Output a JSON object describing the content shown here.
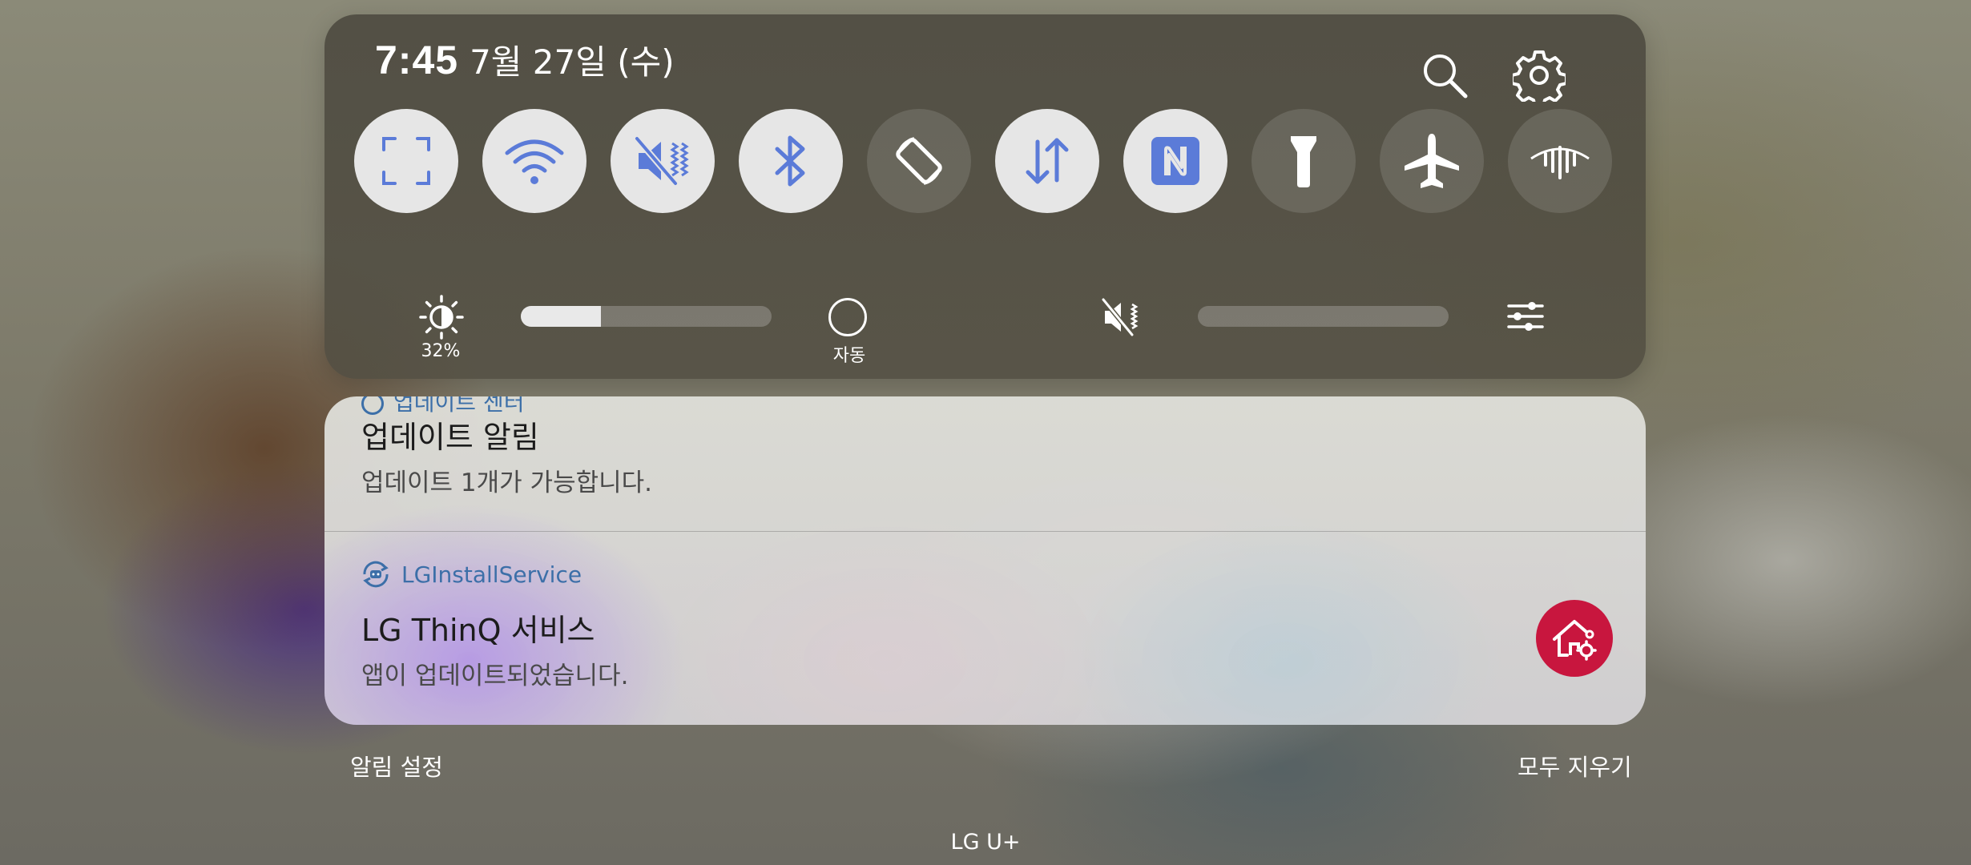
{
  "status": {
    "time": "7:45",
    "date": "7월 27일 (수)",
    "icons": [
      "search-icon",
      "gear-icon"
    ]
  },
  "quick_tiles": [
    {
      "icon": "screenshot-capture-icon",
      "state": "on"
    },
    {
      "icon": "wifi-icon",
      "state": "on"
    },
    {
      "icon": "sound-mute-vibrate-icon",
      "state": "on"
    },
    {
      "icon": "bluetooth-icon",
      "state": "on"
    },
    {
      "icon": "auto-rotate-icon",
      "state": "off"
    },
    {
      "icon": "mobile-data-icon",
      "state": "on"
    },
    {
      "icon": "nfc-icon",
      "state": "on"
    },
    {
      "icon": "flashlight-icon",
      "state": "off"
    },
    {
      "icon": "airplane-mode-icon",
      "state": "off"
    },
    {
      "icon": "dolby-atmos-icon",
      "state": "off"
    }
  ],
  "brightness": {
    "percent_label": "32%",
    "level": 0.32,
    "auto_label": "자동"
  },
  "volume": {
    "level": 0.0
  },
  "notifications": [
    {
      "app": "업데이트 센터",
      "title": "업데이트 알림",
      "text": "업데이트 1개가 가능합니다."
    },
    {
      "app": "LGInstallService",
      "title": "LG ThinQ 서비스",
      "text": "앱이 업데이트되었습니다."
    }
  ],
  "footer": {
    "settings_label": "알림 설정",
    "clear_all_label": "모두 지우기",
    "carrier": "LG U+"
  },
  "colors": {
    "tile_on_bg": "#e6e6e6",
    "tile_icon_blue": "#5b7bd8",
    "app_name_blue": "#3c6fa8",
    "thinq_red": "#c8163e"
  }
}
